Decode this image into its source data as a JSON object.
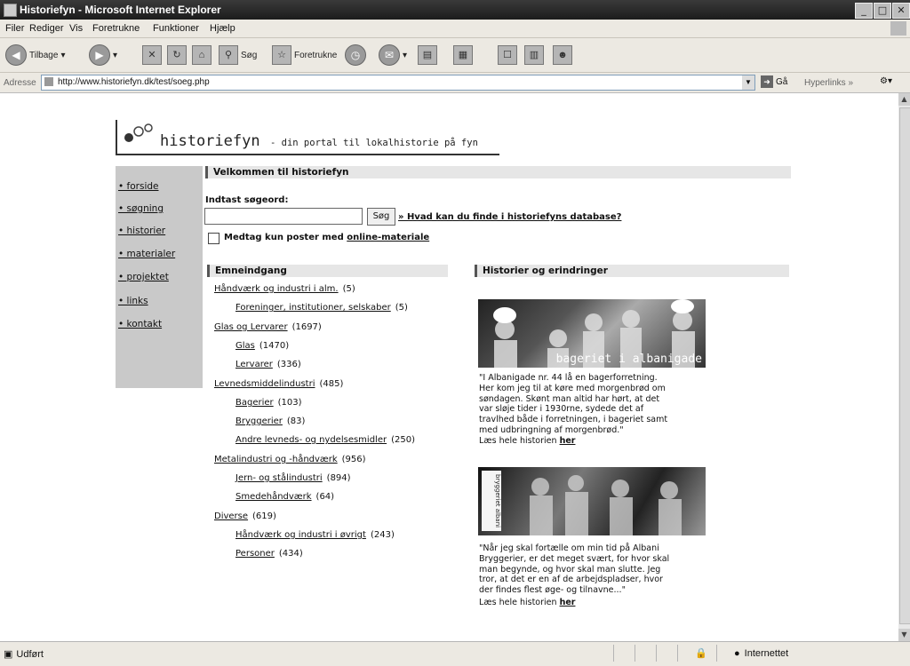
{
  "window": {
    "title": "Historiefyn - Microsoft Internet Explorer"
  },
  "menu": [
    "Filer",
    "Rediger",
    "Vis",
    "Foretrukne",
    "Funktioner",
    "Hjælp"
  ],
  "toolbar": {
    "back_label": "Tilbage",
    "search_label": "Søg",
    "favorites_label": "Foretrukne"
  },
  "address": {
    "label": "Adresse",
    "url": "http://www.historiefyn.dk/test/soeg.php",
    "go_label": "Gå",
    "links_label": "Hyperlinks"
  },
  "site": {
    "logo_text": "historiefyn",
    "tagline": "- din portal til lokalhistorie på fyn",
    "nav": [
      "• forside",
      "• søgning",
      "• historier",
      "• materialer",
      "• projektet",
      "• links",
      "• kontakt"
    ],
    "welcome_heading": "Velkommen til historiefyn",
    "search_label": "Indtast søgeord:",
    "search_value": "",
    "search_button": "Søg",
    "help_link": "» Hvad kan du finde i historiefyns database?",
    "online_checkbox_text": "Medtag kun poster med",
    "online_checkbox_link": "online-materiale",
    "emne_heading": "Emneindgang",
    "categories": [
      {
        "name": "Håndværk og industri i alm.",
        "count": "(5)"
      },
      {
        "name": "Foreninger, institutioner, selskaber",
        "count": "(5)"
      },
      {
        "name": "Glas og Lervarer",
        "count": "(1697)"
      },
      {
        "name": "Glas",
        "count": "(1470)"
      },
      {
        "name": "Lervarer",
        "count": "(336)"
      },
      {
        "name": "Levnedsmiddelindustri",
        "count": "(485)"
      },
      {
        "name": "Bagerier",
        "count": "(103)"
      },
      {
        "name": "Bryggerier",
        "count": "(83)"
      },
      {
        "name": "Andre levneds- og nydelsesmidler",
        "count": "(250)"
      },
      {
        "name": "Metalindustri og -håndværk",
        "count": "(956)"
      },
      {
        "name": "Jern- og stålindustri",
        "count": "(894)"
      },
      {
        "name": "Smedehåndværk",
        "count": "(64)"
      },
      {
        "name": "Diverse",
        "count": "(619)"
      },
      {
        "name": "Håndværk og industri i øvrigt",
        "count": "(243)"
      },
      {
        "name": "Personer",
        "count": "(434)"
      }
    ],
    "hist_heading": "Historier og erindringer",
    "story1_caption": "bageriet i albanigade",
    "story1_lines": [
      "\"I Albanigade nr. 44 lå en bagerforretning.",
      "Her kom jeg til at køre med morgenbrød om",
      "søndagen. Skønt man altid har hørt, at det",
      "var sløje tider i 1930rne, sydede det af",
      "travlhed både i forretningen, i bageriet samt",
      "med udbringning af morgenbrød.\""
    ],
    "story_read_more": "Læs hele historien",
    "story_link": "her",
    "story2_vertical": "bryggeriet albani",
    "story2_lines": [
      "\"Når jeg skal fortælle om min tid på Albani",
      "Bryggerier, er det meget svært, for hvor skal",
      "man begynde, og hvor skal man slutte. Jeg",
      "tror, at det er en af de arbejdspladser, hvor",
      "der findes flest øge- og tilnavne...\""
    ]
  },
  "status": {
    "text": "Udført",
    "zone": "Internettet"
  }
}
